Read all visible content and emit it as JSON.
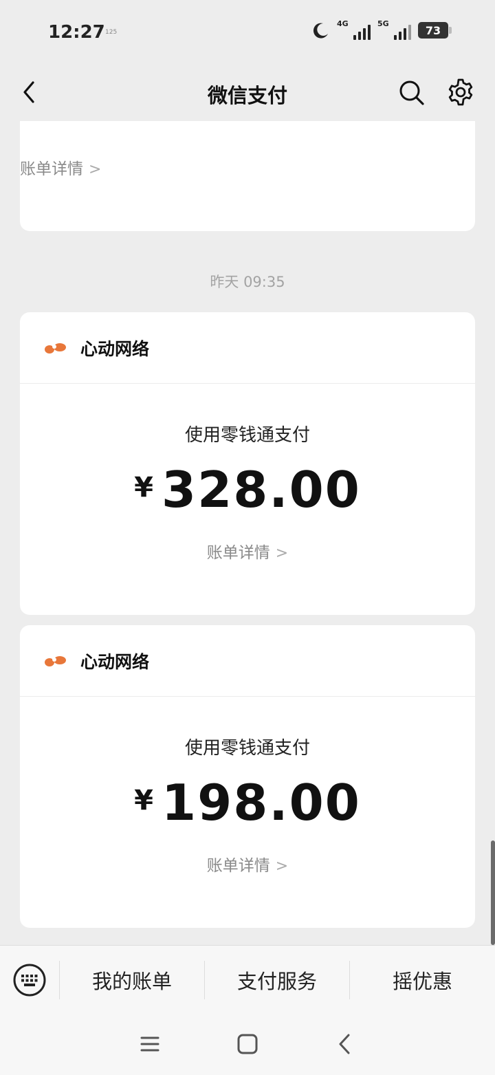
{
  "status_bar": {
    "time": "12:27",
    "tiny_text": "125",
    "signal_1_label": "4G",
    "signal_2_label": "5G",
    "battery": "73"
  },
  "nav": {
    "title": "微信支付",
    "icons": [
      "back-arrow-icon",
      "search-icon",
      "gear-icon"
    ]
  },
  "messages": {
    "bill_link_label": "账单详情",
    "time_label": "昨天 09:35",
    "cards": [
      {
        "merchant": "心动网络",
        "pay_method": "使用零钱通支付",
        "currency": "¥",
        "amount": "328.00"
      },
      {
        "merchant": "心动网络",
        "pay_method": "使用零钱通支付",
        "currency": "¥",
        "amount": "198.00"
      }
    ]
  },
  "bottom_menu": {
    "items": [
      "我的账单",
      "支付服务",
      "摇优惠"
    ]
  },
  "colors": {
    "merchant_logo": "#e8773a",
    "background": "#ededed"
  }
}
